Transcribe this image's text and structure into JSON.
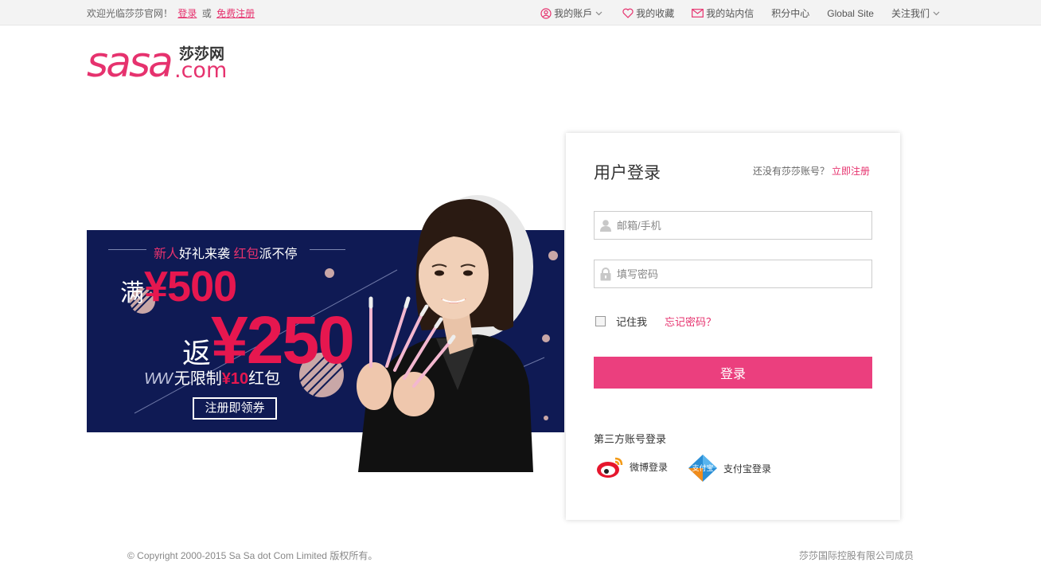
{
  "topbar": {
    "welcome": "欢迎光临莎莎官网！",
    "login_link": "登录",
    "or_text": "或",
    "register_link": "免费注册",
    "my_account": "我的账戶",
    "my_favorites": "我的收藏",
    "my_messages": "我的站内信",
    "points_center": "积分中心",
    "global_site": "Global Site",
    "follow_us": "关注我们"
  },
  "logo": {
    "wordmark": "sasa",
    "cn_name": "莎莎网",
    "domain_suffix": ".com",
    "brand_color": "#e6326e"
  },
  "banner": {
    "headline_hl1": "新人",
    "headline_mid": "好礼来袭",
    "headline_hl2": "红包",
    "headline_end": "派不停",
    "line1_prefix": "满",
    "line1_amount": "¥500",
    "line2_prefix": "返",
    "line2_amount": "¥250",
    "sub_mark": "WW",
    "sub_text": "无限制",
    "sub_amount": "¥10",
    "sub_suffix": "红包",
    "cta": "注册即领券",
    "bg_color": "#0f1a54",
    "accent_color": "#e6174f"
  },
  "login": {
    "title": "用户登录",
    "no_account": "还没有莎莎账号？",
    "register_now": "立即注册",
    "username_placeholder": "邮箱/手机",
    "password_placeholder": "填写密码",
    "remember_me": "记住我",
    "forgot_password": "忘记密码？",
    "submit": "登录",
    "third_party_title": "第三方账号登录",
    "weibo_login": "微博登录",
    "alipay_login": "支付宝登录",
    "alipay_logo_text": "支付宝",
    "button_color": "#eb3f7e"
  },
  "footer": {
    "copyright": "© Copyright 2000-2015 Sa Sa dot Com Limited 版权所有。",
    "member_of": "莎莎国际控股有限公司成员"
  }
}
